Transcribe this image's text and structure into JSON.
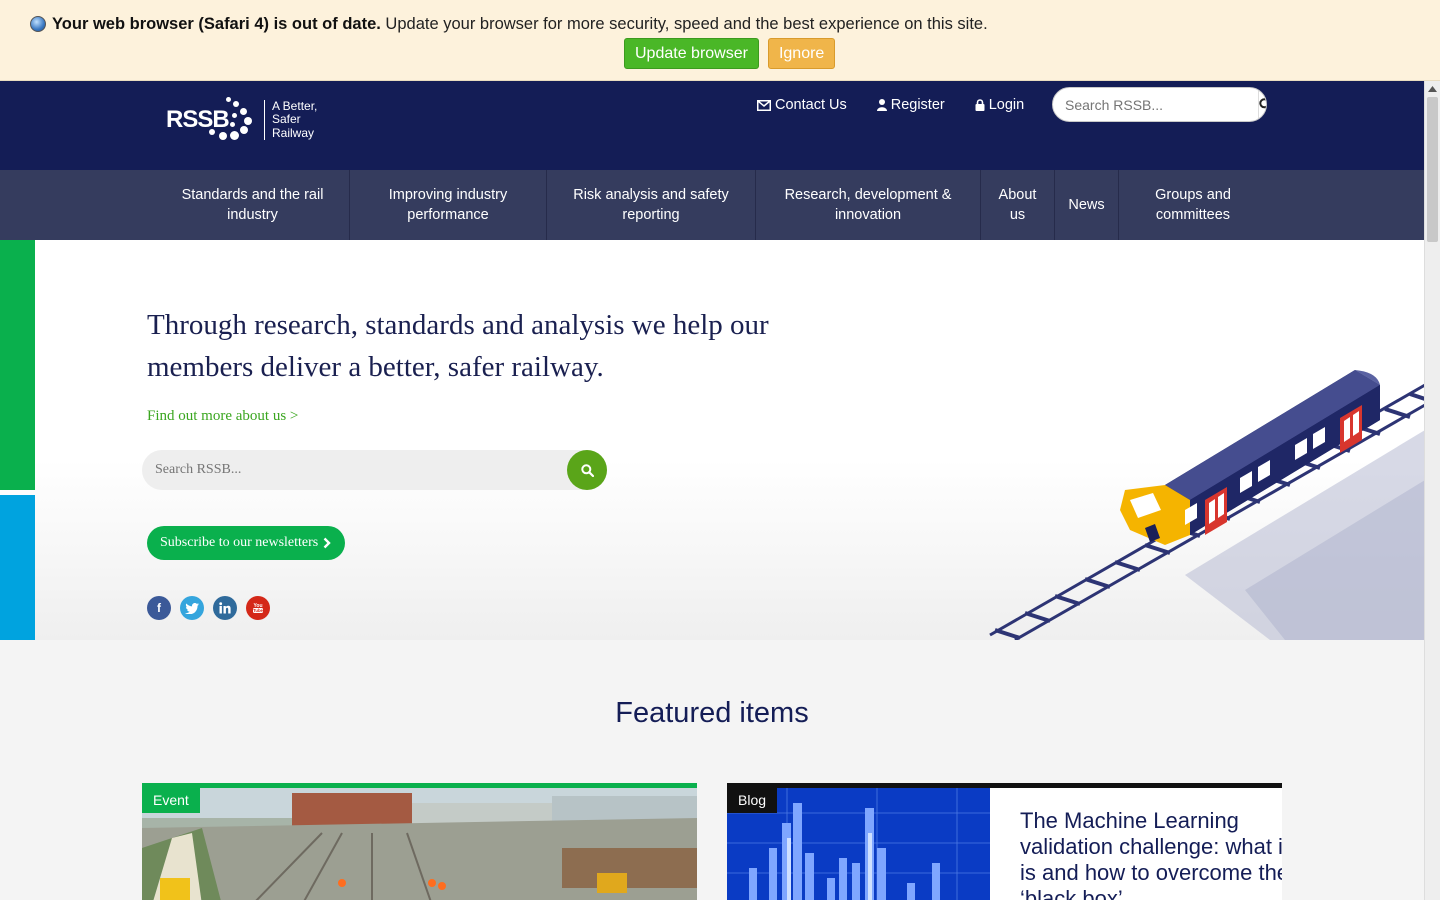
{
  "banner": {
    "bold_text": "Your web browser (Safari 4) is out of date.",
    "text": " Update your browser for more security, speed and the best experience on this site.",
    "update_label": "Update browser",
    "ignore_label": "Ignore"
  },
  "header": {
    "logo_text": "RSSB",
    "tagline_1": "A Better,",
    "tagline_2": "Safer",
    "tagline_3": "Railway",
    "contact_label": "Contact Us",
    "register_label": "Register",
    "login_label": "Login",
    "search_placeholder": "Search RSSB..."
  },
  "nav": {
    "items": [
      {
        "label": "Standards and the rail industry"
      },
      {
        "label": "Improving industry performance"
      },
      {
        "label": "Risk analysis and safety reporting"
      },
      {
        "label": "Research, development & innovation"
      },
      {
        "label": "About us"
      },
      {
        "label": "News"
      },
      {
        "label": "Groups and committees"
      }
    ]
  },
  "hero": {
    "title": "Through research, standards and analysis we help our members deliver a better, safer railway.",
    "link": "Find out more about us >",
    "search_placeholder": "Search RSSB...",
    "subscribe_label": "Subscribe to our newsletters"
  },
  "featured": {
    "title": "Featured items",
    "cards": [
      {
        "tag": "Event",
        "title": ""
      },
      {
        "tag": "Blog",
        "title": "The Machine Learning validation challenge: what it is and how to overcome the ‘black box’"
      }
    ]
  },
  "colors": {
    "header_bg": "#141d56",
    "nav_bg": "#353c5e",
    "brand_green": "#0ab04d",
    "brand_blue": "#00a3df",
    "accent_lime": "#5aa519"
  }
}
